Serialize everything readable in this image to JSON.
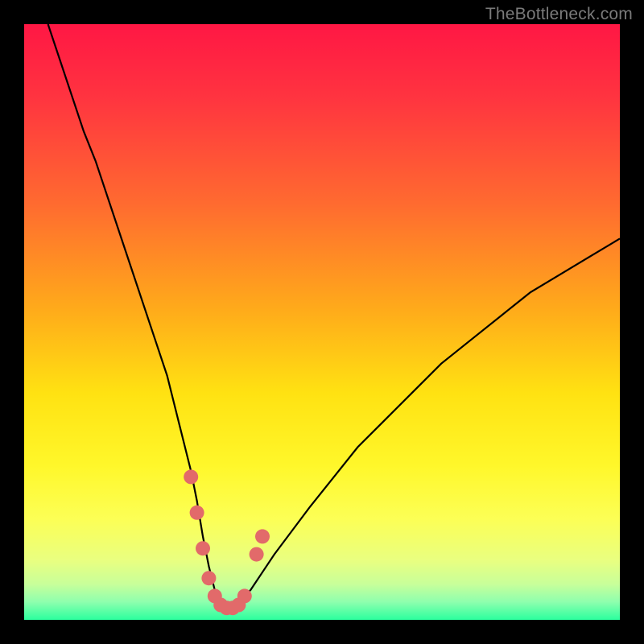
{
  "watermark": "TheBottleneck.com",
  "chart_data": {
    "type": "line",
    "title": "",
    "xlabel": "",
    "ylabel": "",
    "xlim": [
      0,
      100
    ],
    "ylim": [
      0,
      100
    ],
    "gradient_stops": [
      {
        "offset": 0.0,
        "color": "#ff1744"
      },
      {
        "offset": 0.12,
        "color": "#ff3340"
      },
      {
        "offset": 0.3,
        "color": "#ff6a30"
      },
      {
        "offset": 0.48,
        "color": "#ffab1a"
      },
      {
        "offset": 0.62,
        "color": "#ffe212"
      },
      {
        "offset": 0.74,
        "color": "#fff72a"
      },
      {
        "offset": 0.83,
        "color": "#fcff55"
      },
      {
        "offset": 0.9,
        "color": "#e9ff80"
      },
      {
        "offset": 0.94,
        "color": "#c8ff9a"
      },
      {
        "offset": 0.97,
        "color": "#8effae"
      },
      {
        "offset": 1.0,
        "color": "#2bff9e"
      }
    ],
    "series": [
      {
        "name": "bottleneck-curve",
        "color": "#000000",
        "x": [
          4,
          6,
          8,
          10,
          12,
          14,
          16,
          18,
          20,
          22,
          24,
          26,
          27,
          28,
          29,
          30,
          31,
          32,
          33,
          34,
          35,
          36,
          38,
          40,
          42,
          45,
          48,
          52,
          56,
          60,
          65,
          70,
          75,
          80,
          85,
          90,
          95,
          100
        ],
        "y": [
          100,
          94,
          88,
          82,
          77,
          71,
          65,
          59,
          53,
          47,
          41,
          33,
          29,
          25,
          20,
          14,
          9,
          5,
          3,
          2,
          2,
          3,
          5,
          8,
          11,
          15,
          19,
          24,
          29,
          33,
          38,
          43,
          47,
          51,
          55,
          58,
          61,
          64
        ]
      }
    ],
    "highlight_points": {
      "name": "bottleneck-zone",
      "color": "#e26a6a",
      "points": [
        {
          "x": 28,
          "y": 24
        },
        {
          "x": 29,
          "y": 18
        },
        {
          "x": 30,
          "y": 12
        },
        {
          "x": 31,
          "y": 7
        },
        {
          "x": 32,
          "y": 4
        },
        {
          "x": 33,
          "y": 2.5
        },
        {
          "x": 34,
          "y": 2
        },
        {
          "x": 35,
          "y": 2
        },
        {
          "x": 36,
          "y": 2.5
        },
        {
          "x": 37,
          "y": 4
        },
        {
          "x": 39,
          "y": 11
        },
        {
          "x": 40,
          "y": 14
        }
      ]
    }
  }
}
